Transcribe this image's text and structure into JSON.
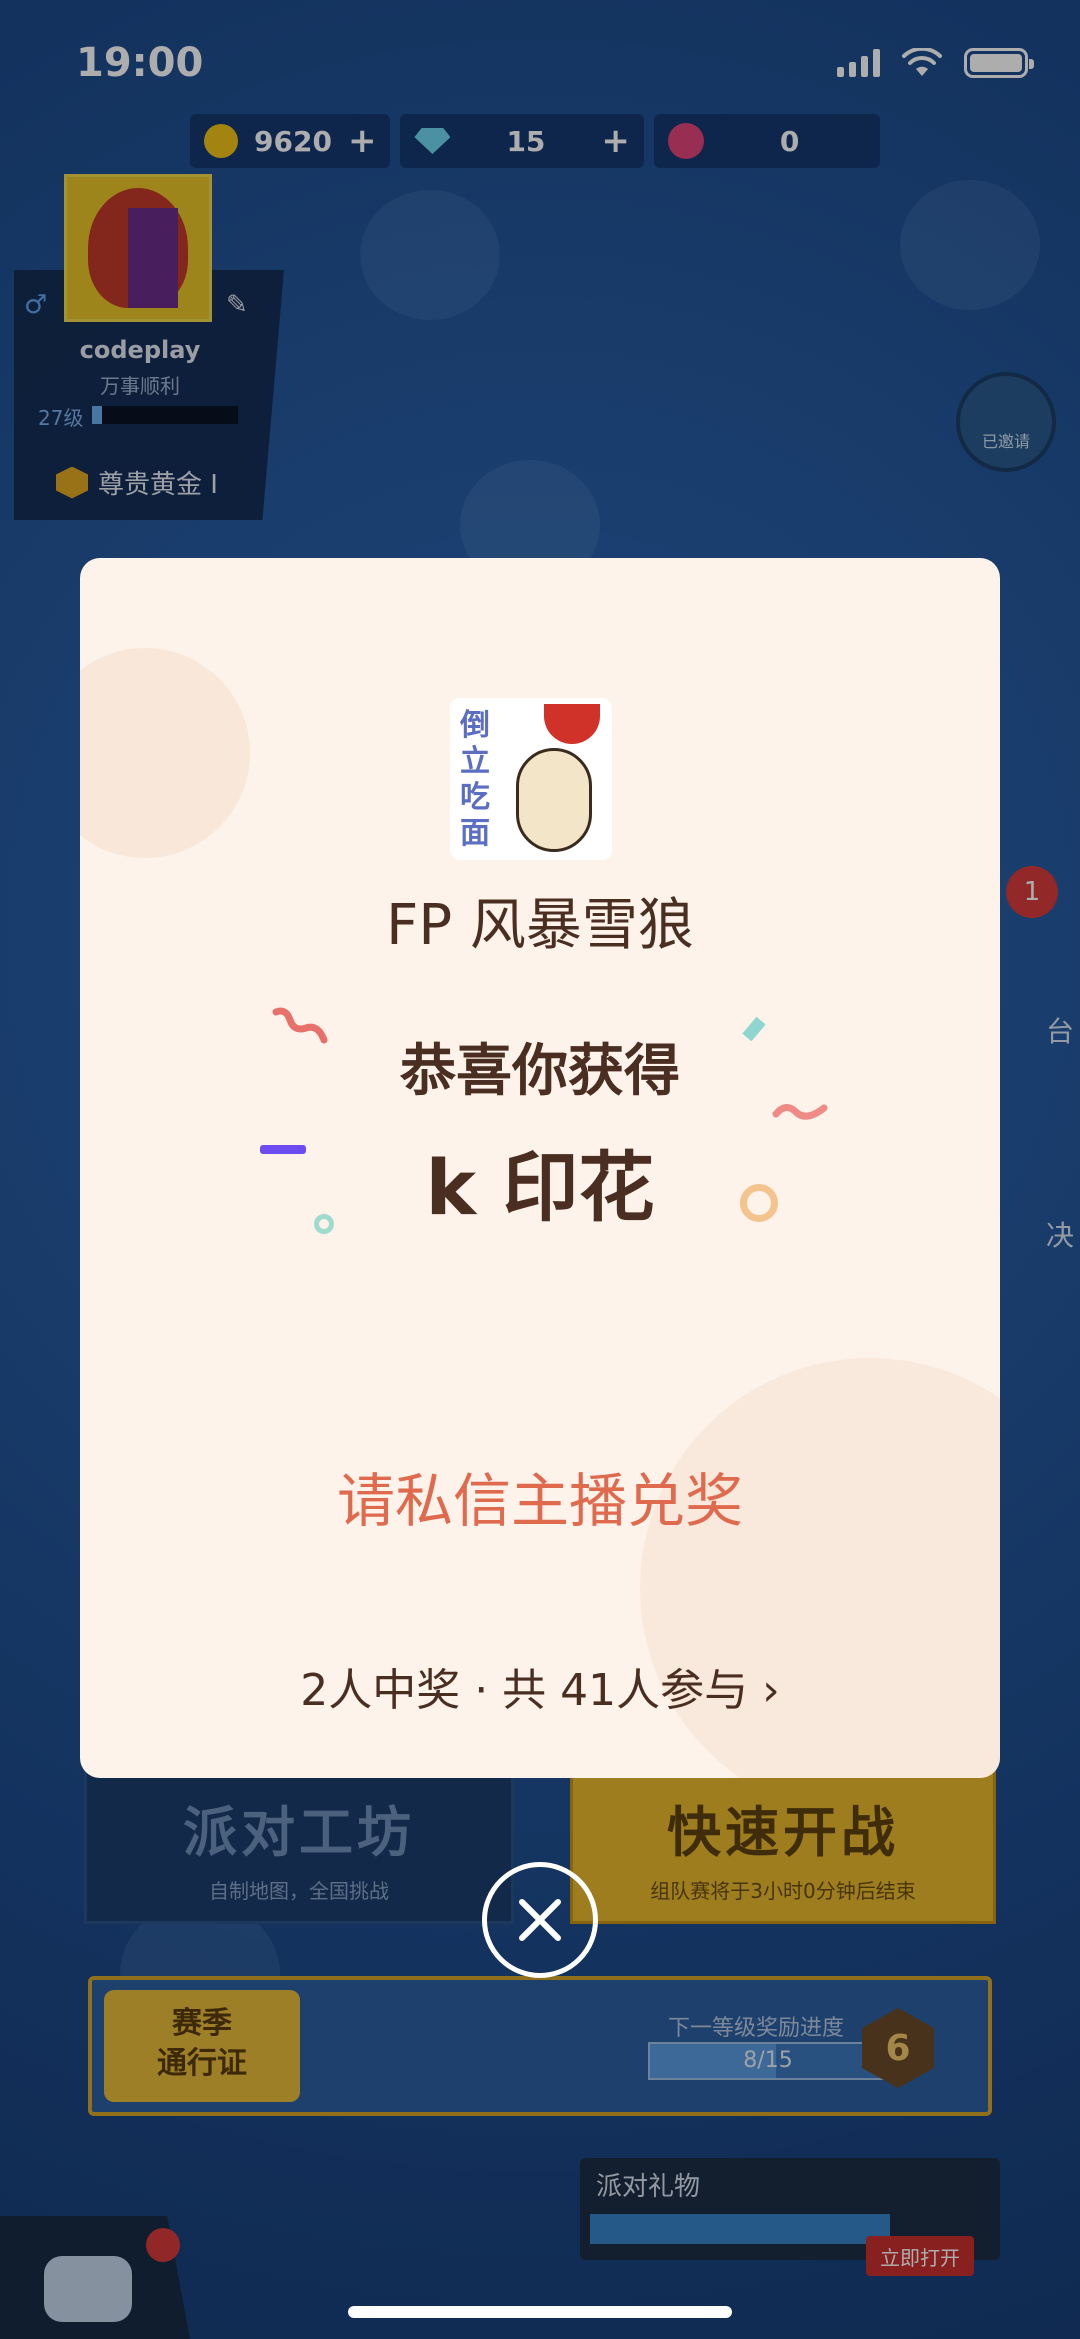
{
  "status_bar": {
    "time": "19:00"
  },
  "currency": {
    "coins": "9620",
    "gems": "15",
    "tokens": "0"
  },
  "profile": {
    "username": "codeplay",
    "tag": "万事顺利",
    "level": "27级",
    "rank": "尊贵黄金 I"
  },
  "invite_badge": "已邀请",
  "notifications": {
    "count": "1"
  },
  "side_labels": {
    "first": "台",
    "second": "决"
  },
  "modes": {
    "party_title": "派对工坊",
    "party_sub": "自制地图，全国挑战",
    "quick_title": "快速开战",
    "quick_sub": "组队赛将于3小时0分钟后结束"
  },
  "season": {
    "badge": "赛季\n通行证",
    "progress_label": "下一等级奖励进度",
    "progress_text": "8/15",
    "progress": 0.533,
    "level": "6"
  },
  "gift": {
    "label": "派对礼物",
    "open": "立即打开"
  },
  "modal": {
    "prize_image_text": "倒立吃面",
    "streamer": "FP 风暴雪狼",
    "congrats": "恭喜你获得",
    "prize": "k 印花",
    "claim": "请私信主播兑奖",
    "winners": "2人中奖 · 共 41人参与 ›"
  },
  "colors": {
    "modal_bg": "#fdf3ea",
    "primary_text": "#4a2e22",
    "accent_orange": "#e06a4e"
  }
}
